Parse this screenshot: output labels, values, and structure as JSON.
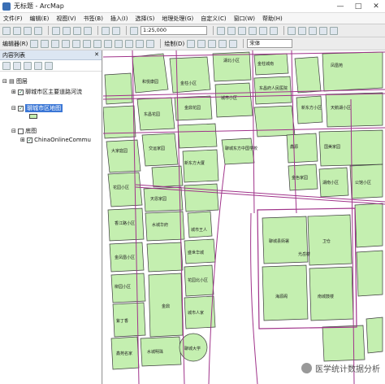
{
  "window": {
    "title": "无标题 - ArcMap",
    "controls": [
      "—",
      "□",
      "✕"
    ]
  },
  "menu": [
    "文件(F)",
    "编辑(E)",
    "视图(V)",
    "书签(B)",
    "插入(I)",
    "选择(S)",
    "地理处理(G)",
    "自定义(C)",
    "窗口(W)",
    "帮助(H)"
  ],
  "toolbar": {
    "scale": "1:25,000",
    "editor": "编辑器(R)",
    "draw": "绘制(D)",
    "font": "宋体"
  },
  "toc": {
    "title": "内容列表",
    "close": "✕",
    "root": "图层",
    "layer_roads": "聊城市区主要道路河流",
    "layer_region": "聊城市区地图",
    "basemap": "底图",
    "basemap_layer": "ChinaOnlineCommu"
  },
  "map": {
    "labels": {
      "l1": "湖北小区",
      "l2": "金柱小区",
      "l3": "金柱城南",
      "l4": "和悦康园",
      "l5": "金鼎花园",
      "l6": "东昌花园",
      "l7": "城市小区",
      "l8": "东昌府人民医院",
      "l9": "新东方小区",
      "l10": "凤凰苑",
      "l11": "天鹅湖小区",
      "l12": "大家庭园",
      "l13": "聊城东方中国学校",
      "l14": "新东方大厦",
      "l15": "交运家园",
      "l16": "城市王人",
      "l17": "花园小区",
      "l18": "天恩家园",
      "l19": "香江路小区",
      "l20": "水城华府",
      "l21": "金凤凰小区",
      "l22": "鑫源",
      "l23": "国美家园",
      "l24": "金鼎",
      "l25": "盛世华城",
      "l26": "聊城县衙署",
      "l27": "卫仓",
      "l28": "海源阁",
      "l29": "南城鼓楼",
      "l30": "柳园小区",
      "l31": "花园北小区",
      "l32": "城市人家",
      "l33": "紫丁香",
      "l34": "鑫苑名家",
      "l35": "水城明珠",
      "l36": "光岳楼",
      "l37": "金色家园",
      "l38": "湖南小区",
      "l39": "聊城大学",
      "l40": "公馆小区"
    },
    "watermark": "医学统计数据分析"
  },
  "colors": {
    "poly_fill": "#c4efb0",
    "poly_stroke": "#3d3d3d",
    "road": "#a0338a"
  }
}
